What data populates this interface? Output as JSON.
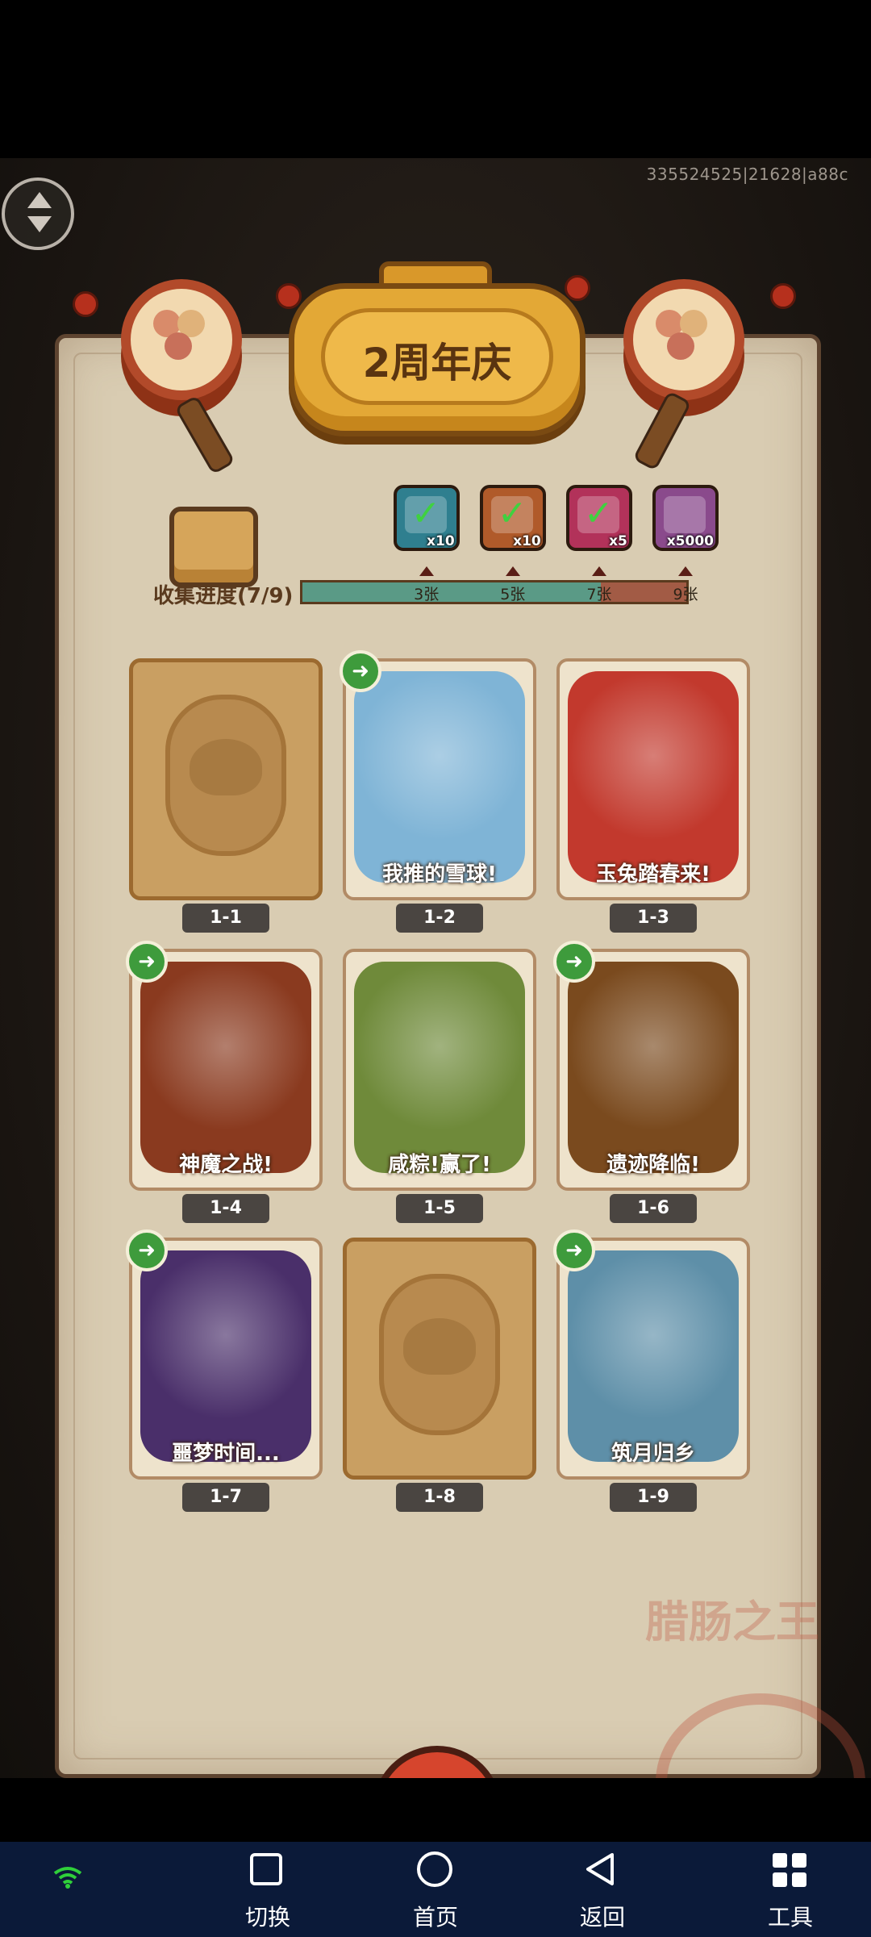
{
  "debug_id": "335524525|21628|a88c",
  "event_title": "2周年庆",
  "progress": {
    "label": "收集进度(7/9)",
    "collected": 7,
    "total": 9,
    "milestones": [
      {
        "label": "3张",
        "reward_qty": "x10",
        "icon": "chest-icon",
        "color": "#2f7f8f",
        "claimed": true
      },
      {
        "label": "5张",
        "reward_qty": "x10",
        "icon": "key-icon",
        "color": "#b05a2a",
        "claimed": true
      },
      {
        "label": "7张",
        "reward_qty": "x5",
        "icon": "orb-icon",
        "color": "#b2325a",
        "claimed": true
      },
      {
        "label": "9张",
        "reward_qty": "x5000",
        "icon": "crystal-icon",
        "color": "#8a4a8c",
        "claimed": false
      }
    ]
  },
  "cards": [
    {
      "id": "1-1",
      "caption": "",
      "unlocked": false,
      "art_color": "#c99f62"
    },
    {
      "id": "1-2",
      "caption": "我推的雪球!",
      "unlocked": true,
      "art_color": "#7fb4d6"
    },
    {
      "id": "1-3",
      "caption": "玉兔踏春来!",
      "unlocked": true,
      "art_color": "#c2392d"
    },
    {
      "id": "1-4",
      "caption": "神魔之战!",
      "unlocked": true,
      "art_color": "#8a3a1f"
    },
    {
      "id": "1-5",
      "caption": "咸粽!赢了!",
      "unlocked": true,
      "art_color": "#6f8a3a"
    },
    {
      "id": "1-6",
      "caption": "遗迹降临!",
      "unlocked": true,
      "art_color": "#7a4a1e"
    },
    {
      "id": "1-7",
      "caption": "噩梦时间...",
      "unlocked": true,
      "art_color": "#4a2f6a"
    },
    {
      "id": "1-8",
      "caption": "",
      "unlocked": false,
      "art_color": "#c99f62"
    },
    {
      "id": "1-9",
      "caption": "筑月归乡",
      "unlocked": true,
      "art_color": "#5e8fa8"
    }
  ],
  "seal_text": "腊肠之王",
  "close_icon": "close-icon",
  "nav": [
    {
      "label": "切换",
      "icon": "square-icon"
    },
    {
      "label": "首页",
      "icon": "circle-icon"
    },
    {
      "label": "返回",
      "icon": "back-triangle-icon"
    },
    {
      "label": "工具",
      "icon": "grid-icon"
    }
  ],
  "wifi_icon": "wifi-icon"
}
